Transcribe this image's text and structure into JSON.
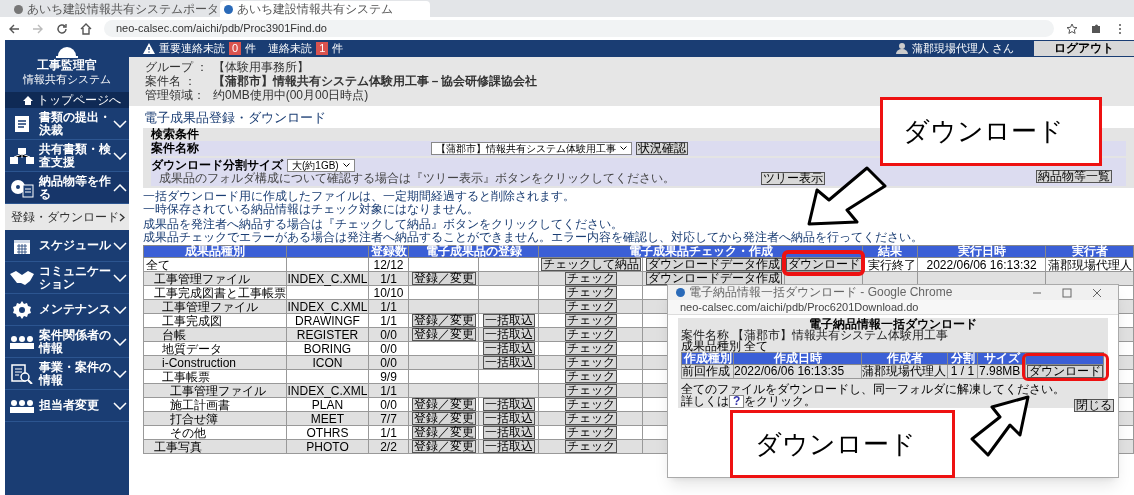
{
  "browser": {
    "tabs": [
      {
        "label": "あいち建設情報共有システムポータ",
        "selected": false
      },
      {
        "label": "あいち建設情報共有システム",
        "selected": true
      }
    ],
    "url": "neo-calsec.com/aichi/pdb/Proc3901Find.do"
  },
  "header": {
    "important_label": "重要連絡未読",
    "important_count": "0",
    "important_unit": "件",
    "unread_label": "連絡未読",
    "unread_count": "1",
    "unread_unit": "件",
    "user": "蒲郡現場代理人 さん",
    "logout": "ログアウト"
  },
  "sidebar": {
    "logo_title": "工事監理官",
    "logo_subtitle": "情報共有システム",
    "top_link": "トップページへ",
    "items": [
      {
        "kind": "document",
        "label": "書類の提出・決裁",
        "expanded": false
      },
      {
        "kind": "share",
        "label": "共有書類・検査支援",
        "expanded": false
      },
      {
        "kind": "deliver",
        "label": "納品物等を作る",
        "expanded": true,
        "children": [
          {
            "label": "登録・ダウンロード"
          }
        ]
      },
      {
        "kind": "calendar",
        "label": "スケジュール",
        "expanded": false
      },
      {
        "kind": "handshake",
        "label": "コミュニケーション",
        "expanded": false
      },
      {
        "kind": "gear",
        "label": "メンテナンス",
        "expanded": false
      },
      {
        "kind": "people",
        "label": "案件関係者の情報",
        "expanded": false
      },
      {
        "kind": "search",
        "label": "事業・案件の情報",
        "expanded": false
      },
      {
        "kind": "people",
        "label": "担当者変更",
        "expanded": false
      }
    ]
  },
  "info": [
    {
      "label": "グループ ：",
      "value": "【体験用事務所】"
    },
    {
      "label": "案件名 ：",
      "value": "【蒲郡市】情報共有システム体験用工事－協会研修課協会社"
    },
    {
      "label": "管理領域：",
      "value": "约0MB使用中(00月00日時点)"
    }
  ],
  "page_title": "電子成果品登録・ダウンロード",
  "search": {
    "title": "検索条件",
    "project_label": "案件名称",
    "project_value": "【蒲郡市】情報共有システム体験用工事",
    "status_button": "状況確認",
    "size_label": "ダウンロード分割サイズ",
    "size_value": "大(約1GB)",
    "tree_note": "成果品のフォルダ構成について確認する場合は『ツリー表示』ボタンをクリックしてください。",
    "tree_button": "ツリー表示",
    "list_button": "納品物等一覧"
  },
  "notes": [
    "一括ダウンロード用に作成したファイルは、一定期間経過すると削除されます。",
    "一時保存されている納品情報はチェック対象にはなりません。",
    "成果品を発注者へ納品する場合は『チェックして納品』ボタンをクリックしてください。",
    "成果品チェックでエラーがある場合は発注者へ納品することができません。エラー内容を確認し、対応してから発注者へ納品を行ってください。"
  ],
  "table": {
    "columns": [
      "成果品種別",
      "登録数",
      "電子成果品の登録",
      "電子成果品チェック・作成",
      "結果",
      "実行日時",
      "実行者"
    ],
    "rows": [
      {
        "name": "全て",
        "count": "12/12",
        "check_button": "チェックして納品",
        "create_button": "ダウンロードデータ作成",
        "download_button": "ダウンロード",
        "result": "実行終了",
        "executed_at": "2022/06/06 16:13:32",
        "executed_by": "蒲郡現場代理人",
        "children": [
          {
            "name": "工事管理ファイル",
            "code": "INDEX_C.XML",
            "count": "1/1",
            "register_button": "登録／変更",
            "check_button": "チェック",
            "create_button": "ダウンロードデータ作成"
          },
          {
            "name": "工事完成図書と工事帳票",
            "count": "10/10",
            "check_button": "チェック",
            "children": [
              {
                "name": "工事管理ファイル",
                "code": "INDEX_C.XML",
                "count": "1/1",
                "check_button": "チェック"
              },
              {
                "name": "工事完成図",
                "code": "DRAWINGF",
                "count": "1/1",
                "register_button": "登録／変更",
                "import_button": "一括取込",
                "check_button": "チェック"
              },
              {
                "name": "台帳",
                "code": "REGISTER",
                "count": "0/0",
                "register_button": "登録／変更",
                "import_button": "一括取込",
                "check_button": "チェック"
              },
              {
                "name": "地質データ",
                "code": "BORING",
                "count": "0/0",
                "import_button": "一括取込",
                "check_button": "チェック"
              },
              {
                "name": "i-Construction",
                "code": "ICON",
                "count": "0/0",
                "import_button": "一括取込",
                "check_button": "チェック"
              },
              {
                "name": "工事帳票",
                "count": "9/9",
                "check_button": "チェック",
                "children": [
                  {
                    "name": "工事管理ファイル",
                    "code": "INDEX_C.XML",
                    "count": "1/1",
                    "check_button": "チェック"
                  },
                  {
                    "name": "施工計画書",
                    "code": "PLAN",
                    "count": "0/0",
                    "register_button": "登録／変更",
                    "import_button": "一括取込",
                    "check_button": "チェック"
                  },
                  {
                    "name": "打合せ簿",
                    "code": "MEET",
                    "count": "7/7",
                    "register_button": "登録／変更",
                    "import_button": "一括取込",
                    "check_button": "チェック"
                  },
                  {
                    "name": "その他",
                    "code": "OTHRS",
                    "count": "1/1",
                    "register_button": "登録／変更",
                    "import_button": "一括取込",
                    "check_button": "チェック"
                  }
                ]
              }
            ]
          },
          {
            "name": "工事写真",
            "code": "PHOTO",
            "count": "2/2",
            "register_button": "登録／変更",
            "import_button": "一括取込",
            "check_button": "チェック"
          }
        ]
      }
    ]
  },
  "popup": {
    "title": "電子納品情報一括ダウンロード - Google Chrome",
    "url": "neo-calsec.com/aichi/pdb/Proc6201Download.do",
    "heading": "電子納品情報一括ダウンロード",
    "project": "案件名称 【蒲郡市】情報共有システム体験用工事",
    "kind": "成果品種別 全て",
    "columns": [
      "作成種別",
      "作成日時",
      "作成者",
      "分割",
      "サイズ"
    ],
    "rows": [
      {
        "type": "前回作成",
        "created_at": "2022/06/06 16:13:35",
        "creator": "蒲郡現場代理人",
        "part": "1 / 1",
        "size": "7.98MB",
        "button": "ダウンロード"
      }
    ],
    "note": "全てのファイルをダウンロードし、同一フォルダに解凍してください。",
    "help_before": "詳しくは",
    "help_icon": "?",
    "help_after": "をクリック。",
    "close_button": "閉じる"
  },
  "callouts": [
    {
      "text": "ダウンロード"
    },
    {
      "text": "ダウンロード"
    }
  ]
}
